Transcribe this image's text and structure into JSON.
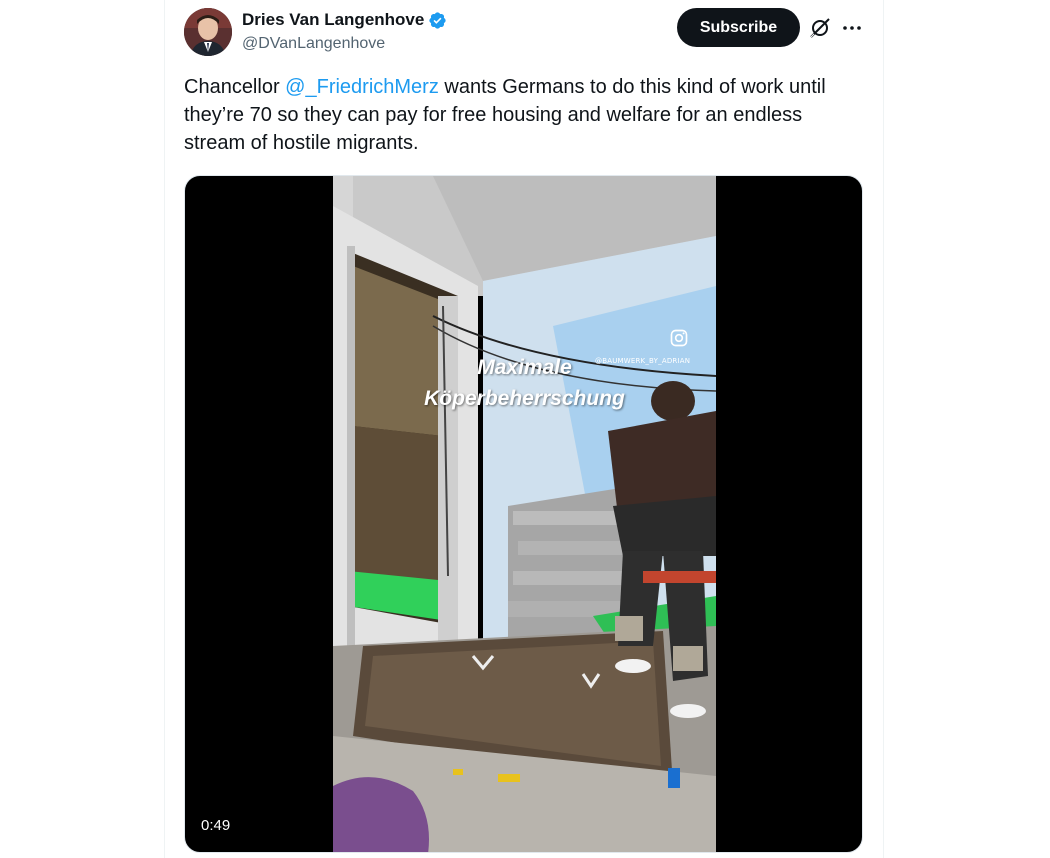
{
  "author": {
    "display_name": "Dries Van Langenhove",
    "handle": "@DVanLangenhove",
    "verified": true
  },
  "actions": {
    "subscribe_label": "Subscribe",
    "grok_icon": "grok-icon",
    "more_icon": "more-dots-icon"
  },
  "tweet": {
    "text_before": "Chancellor ",
    "mention": "@_FriedrichMerz",
    "text_after": " wants Germans to do this kind of work until they’re 70 so they can pay for free housing and welfare for an endless stream of hostile migrants."
  },
  "media": {
    "type": "video",
    "duration": "0:49",
    "overlay_line1": "Maximale",
    "overlay_line2": "Köperbeherrschung",
    "watermark": "@BAUMWERK_BY_ADRIAN"
  },
  "colors": {
    "accent": "#1d9bf0",
    "text": "#0f1419",
    "secondary": "#536471",
    "button_bg": "#0f1419"
  }
}
